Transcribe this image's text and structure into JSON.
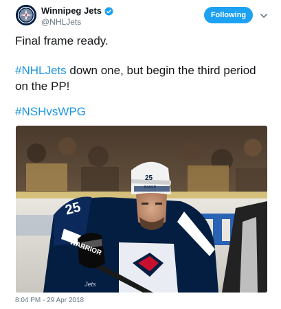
{
  "author": {
    "display_name": "Winnipeg Jets",
    "handle": "@NHLJets",
    "verified": true,
    "avatar_icon": "jets-logo-icon"
  },
  "actions": {
    "follow_label": "Following",
    "menu_icon": "chevron-down-icon"
  },
  "tweet": {
    "line1": "Final frame ready.",
    "hashtag1": "#NHLJets",
    "line2_rest": " down one, but begin the third period on the PP!",
    "hashtag2": "#NSHvsWPG"
  },
  "media": {
    "jersey_number": "25",
    "helmet_brand": "BAUER",
    "stick_brand": "WARRIOR",
    "pants_text": "Jets"
  },
  "timestamp": "8:04 PM - 29 Apr 2018",
  "colors": {
    "accent": "#1da1f2",
    "hashtag": "#1b95e0",
    "jets_navy": "#041e42",
    "secondary_text": "#657786"
  }
}
